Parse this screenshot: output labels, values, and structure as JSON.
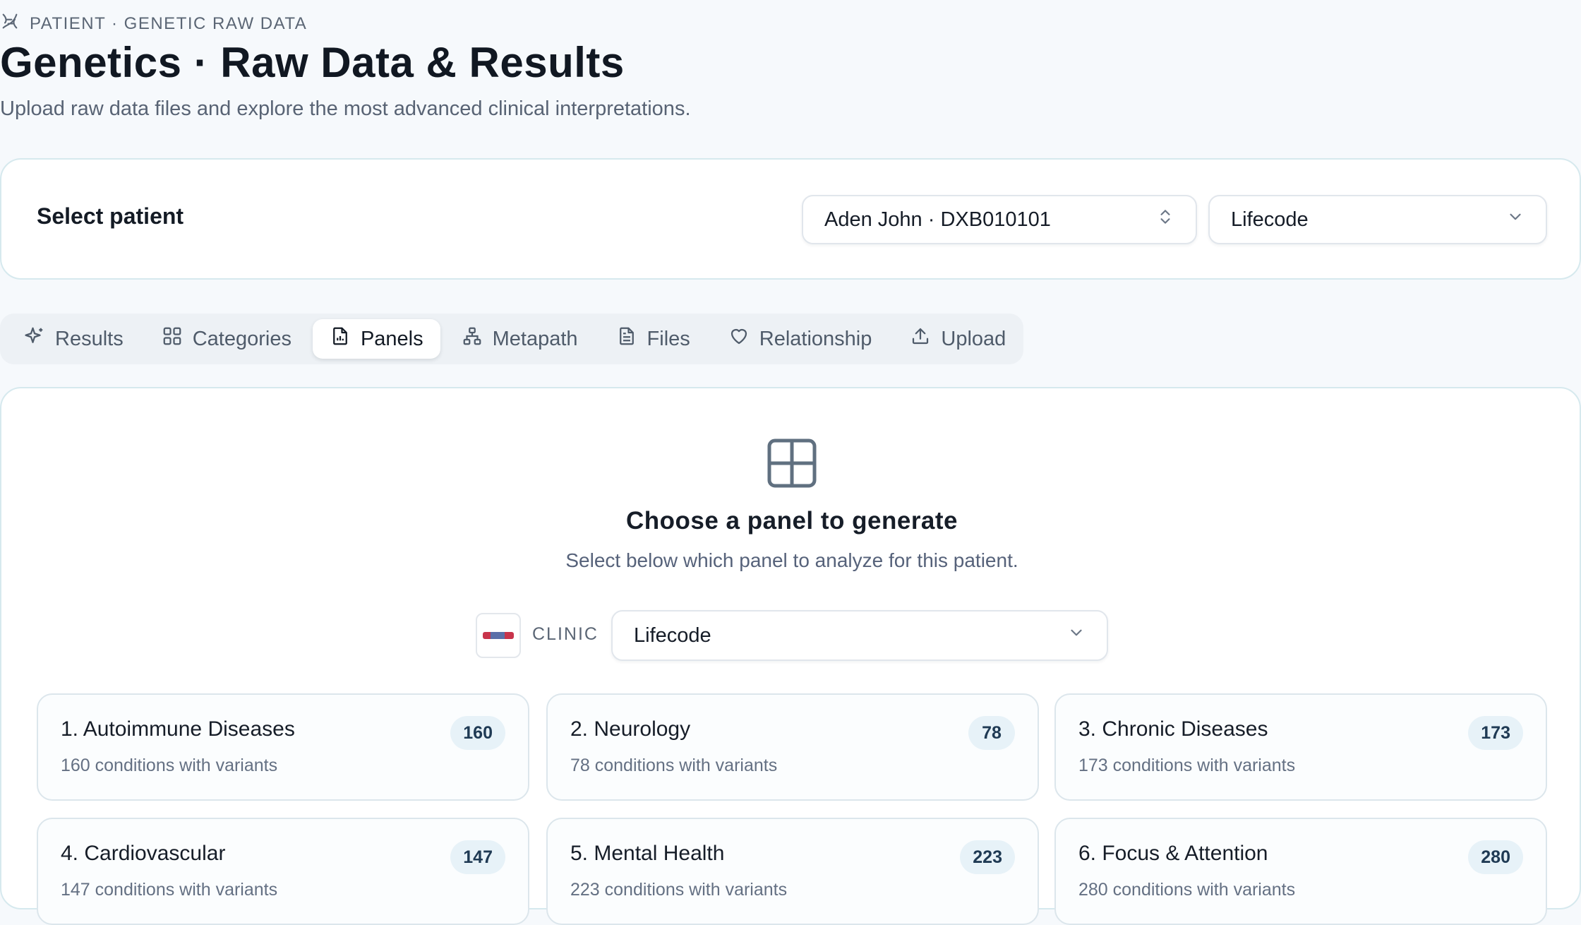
{
  "header": {
    "eyebrow": "PATIENT · GENETIC RAW DATA",
    "title": "Genetics · Raw Data & Results",
    "subtitle": "Upload raw data files and explore the most advanced clinical interpretations."
  },
  "patient_selector": {
    "label": "Select patient",
    "patient_value": "Aden John · DXB010101",
    "clinic_value": "Lifecode"
  },
  "tabs": [
    {
      "label": "Results",
      "icon": "sparkles-icon",
      "active": false
    },
    {
      "label": "Categories",
      "icon": "grid-icon",
      "active": false
    },
    {
      "label": "Panels",
      "icon": "document-chart-icon",
      "active": true
    },
    {
      "label": "Metapath",
      "icon": "network-icon",
      "active": false
    },
    {
      "label": "Files",
      "icon": "file-text-icon",
      "active": false
    },
    {
      "label": "Relationship",
      "icon": "heart-icon",
      "active": false
    },
    {
      "label": "Upload",
      "icon": "upload-icon",
      "active": false
    }
  ],
  "panel_chooser": {
    "title": "Choose a panel to generate",
    "subtitle": "Select below which panel to analyze for this patient.",
    "clinic_label": "CLINIC",
    "clinic_value": "Lifecode"
  },
  "panels": [
    {
      "name": "1. Autoimmune Diseases",
      "count": "160",
      "desc": "160 conditions with variants"
    },
    {
      "name": "2. Neurology",
      "count": "78",
      "desc": "78 conditions with variants"
    },
    {
      "name": "3. Chronic Diseases",
      "count": "173",
      "desc": "173 conditions with variants"
    },
    {
      "name": "4. Cardiovascular",
      "count": "147",
      "desc": "147 conditions with variants"
    },
    {
      "name": "5. Mental Health",
      "count": "223",
      "desc": "223 conditions with variants"
    },
    {
      "name": "6. Focus & Attention",
      "count": "280",
      "desc": "280 conditions with variants"
    }
  ],
  "colors": {
    "background": "#f6f9fc",
    "card_border": "#d6e9ee",
    "badge_bg": "#e7f2f8",
    "badge_text": "#1f3a54"
  }
}
